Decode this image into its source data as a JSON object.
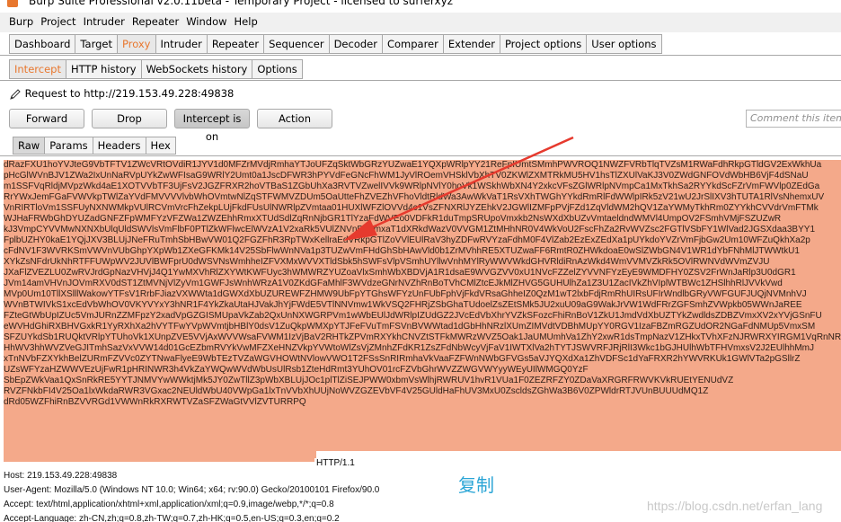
{
  "window": {
    "title": "Burp Suite Professional v2.0.11beta - Temporary Project - licensed to surferxyz"
  },
  "menu": [
    "Burp",
    "Project",
    "Intruder",
    "Repeater",
    "Window",
    "Help"
  ],
  "main_tabs": [
    "Dashboard",
    "Target",
    "Proxy",
    "Intruder",
    "Repeater",
    "Sequencer",
    "Decoder",
    "Comparer",
    "Extender",
    "Project options",
    "User options"
  ],
  "main_tab_active": "Proxy",
  "proxy_tabs": [
    "Intercept",
    "HTTP history",
    "WebSockets history",
    "Options"
  ],
  "proxy_tab_active": "Intercept",
  "request": {
    "label": "Request to http://219.153.49.228:49838"
  },
  "buttons": {
    "forward": "Forward",
    "drop": "Drop",
    "intercept": "Intercept is on",
    "action": "Action"
  },
  "comment": {
    "placeholder": "Comment this item"
  },
  "view_tabs": [
    "Raw",
    "Params",
    "Headers",
    "Hex"
  ],
  "view_tab_active": "Raw",
  "body_lines": [
    "dRazFXU1hoYVJteG9VbTFTV1ZWcVRtOVdiR1JYV1d0MFZrMVdjRmhaYTJoUFZqSktWbGRzYUZwaE1YQXpWRlpYY21ReFpIUmtSMmhPWVROQ1NWZFVRbTlqTVZsM1RWaFdhRkpGTldGV2ExWkhUa",
    "pHcGlWVnBJV1ZWa2IxUnNaRVpUYkZwWFIsaG9WRlY2Umt0a1JscDFWR3hPYVdFeGNcFhWM1JyVlROemVHSklVbXhTV0ZKWlZXMTRkMU5HV1hsTlZXUlVaKJ3V0ZWdGNFOVdWbHB6VjF4dSNaU",
    "m1SSFVqRldjMVpzWkd4aE1XOTVVbTF3UjFsV2JGZFRXR2hoVTBaS1ZGbUhXa3RVTVZwelIVVk9WRlpNVlY0hoVk1WSkhWbXN4Y2xkcVFsZGlWRlpNVmpCa1MxTkhSa2RYYkdScFZrVmFWVlp0ZEdGa",
    "RrYWxJemFGaFVWVkpTWlZaYVdFMVVVVlvbWhOVmtwNlZqSTFWMVZDUm5OaUtteFhZVEZhVFhoVldtRldWa3AwWkVaT1RsVXhTWGhYYkdRmRlFdWWlpIRk5zV21wU2JrSlIXV3hTUTA1RlVsNhemxUV",
    "VnRIRTloVm1SSFUyNXNWMkpVUlRCVmVrcFhZekpLUjFkdFUsUlNWRlpZVmtaa01HUXlWFZlOVVd4c1VsZFNXRlJYZEhkV2JGWlIZMFpPVjFZd1ZqVldWM2hQV1ZaYWMyTkhRm0ZYYkhCVVdrVmFTMk",
    "WJHaFRWbGhDYUZadGNFZFpWMFYzVFZWa1ZWZEhhRmxXTUdSdlZqRnNjbGR1TlYzaFdWVEo0VDFkR1duTmpSRUpoVmxkb2NsWXdXbUZvVmtaeldndWMVl4UmpOV2FSmhVMjFSZUZwR",
    "kJ3VmpCYVVMwNXNXbUlqUldSWVlsVmFlbF0PTlZkWFlwcElWVzA1V2xaRk5VUlZNVnByVmxaT1dXRkdWazV0VVGM1ZtMHhNR0V4WkVoU2FscFhZa2RvWVZsc2FGTlVSbFY1WlVad2JGSXdaa3BYY1",
    "FplbUZHY0kaE1YQjJXV3BLUjJNeFRuTmhSbHBwVW01Q2FGZFhR3RpTWxKellraEdVRkpGTlZoVVlEUlRaV3hyZDFwRVYzaFdhM0F4VlZab2EzExZEdXa1pUYkdoYVZrVmFjbGw2Um10WFZuQkhXa2p",
    "cFdNV1F3WVRKSmVWVnVUbGhpYXpWb1ZXeGFKMk14V25SbFlwWnNVa1p3TUZwVmFHdGhSbHAwVld0b1ZrMVhhRE5XTUZwaFF6RmtR0ZHWkdoaE0wSlZWbGN4V1WR1dYbFNhMlJTWWtkU1",
    "XYkZsNFdrUkNhRTFFUWpWV2JUVlBWFprU0dWSVNsWmhheIZFVXMxWVVXTldSbk5hSWFsVlpVSmhUYllwVnhMYlRyWWVWkdGHVRldiRnAzWkd4WmVVMVZkRk5OVlRWNVdWVmZVJU",
    "JXaFlZVEZLU0ZwRVJrdGpNazVHVjJ4Q1YwMXVhRlZXYWtKWFUyc3hWMWRZYUZoaVlxSmhWbXBDVjA1R1dsaE9WVGZVV0xU1NVcFZZelZYVVNFYzEyE9WMDFHY0ZSV2FrWnJaRlp3U0dGR1",
    "JVm14amVHVnJOVmRXV0dST1ZtMVNjVlZyVm1GWFJsWnhWRzA1V0ZKdGFaMhlF3WVdzeGNrNVZhRnBoTVhCMlZtcEJkMlZHVG5GUHUlhZa1Z3U1ZacIVkZhVIplWTBWc1ZHSlhhRlJVVkVwd",
    "MVp0Um10TllXSlllWakowYTFsV1RrbFJiazVXWWta1dGWXdXbUZUREWFZHMW9UbFpYTGhsWFYzUnFUbFphVjFkdVRsaGhheIZ0QzM1wT2lxbFdjRmRhUIRsUFIrWndlbGRyVWFGUFJUQjNVMnhVJ",
    "WVnBTWIVkS1xcEdVbWhOV0VKYVYxY3hNR1F4YkZkaUtaHJVakJhYjFWdE5VTlNNVmw1WkVSQ2FHRjZSbGhaTUdoelZsZEtSMk5JU2xuU09aG9WakJrVW1WdFRrZGFSmhZVWpkb05WWnJaREE",
    "FZteGtWbUpIZUc5VmJURnZZMFpzY2xadVpGZGISMUpaVkZab2QxUnNXWGRPVm1wWbEUlJdWRlpIZUdGZ2JVcEdVbXhrYVZkSFozcFhiRnBoV1ZkU1JmdVdXbUZTYkZwdldsZDBZVmxXV2xYVjGSnFU",
    "eWVHdGhiRXBHVGxkR1YyRXhXa2hVYTFwYVpWVmtjbHBlY0dsV1ZuQkpWMXpYTJFeFVuTmFSVnBVWWtad1dGbHhNRzlXUmZIMVdtVDBhMUpYY0RGV1IzaFBZmRGZUdOR2NGaFdNMUp5VmxSM",
    "SFZUYkdSb1RUQktVRlpYTUhoVk1XUnpZVE5VVjAxWVVWsaFVWM1IzVjBaV2RHTkZPVmRXYkhCNVZtSTFkMWRzWVZ5Oak1JaUMUmhVa1ZhY2xwR1dsTmpNazV1ZHkxTVhXFzNJRWRXYIRGM1VqRnNRkpZV",
    "HhWV3hhWVZVeGJITmhSazVxVVW14d01GcEZbmRVYkVwMFZXeHNZVkpYVWtoWlZsVjZMnhZFdKR1ZsZFdNbWcyVjFaV1IWTXlVa2hTYTJSWVRFJRjRlI3Wkc1bGJHUlhWbTFHVmxsV2J2EUlhhMmJ",
    "xTnNVbFZXYkhBelZURmFZVVc0ZYTNwaFlyeE9WbTEzTVZaWGVHOWtNVlowVWO1T2FSsSnRIRmhaVkVaaFZFWnNWbGFVGs5aVJYQXdXa1ZhVDFSc1dYaFRXR2hYWVRKUk1GWlVTa2pGSllrZ",
    "UZsWFYzaHZWWVEzUjFwR1pHRINWR3h4VkZaYWQwWVdWbUsUlRsb1ZteHdRmt3YUhOV01rcFZVbGhrWVZZWGVWYyyWEyUIlWMGQ0YzF",
    "SbEpZWkVaa1QxSnRkRE5YYTJNMVYwWWktjMk5JY0ZwTllZ3pWbXBLUjJOc1plTlZiSEJPWW0xbmVsWlhjRWRUV1hvR1VUa1F0ZEZRFZY0ZDaVaXRGRFRWVKVkRUEtYENUdVZ",
    "RVZFNkbFI4V25Oa1lxWkdaRWR3VGxac2NEUldWbU40VWpGa1lxTnVVbXhUUjNoWVZGZEVbVF4V25GUldHaFhUV3MxU0ZscldsZGhWa3B6V0ZPWldrRTJVUnBUUUdMQ1Z",
    "dRd05WZFhiRnBZVVRGd1VWWnRkRXRWTVZaSFZWaGtVVlZVTURRPQ"
  ],
  "http_version": "HTTP/1.1",
  "headers": [
    "Host: 219.153.49.228:49838",
    "User-Agent: Mozilla/5.0 (Windows NT 10.0; Win64; x64; rv:90.0) Gecko/20100101 Firefox/90.0",
    "Accept: text/html,application/xhtml+xml,application/xml;q=0.9,image/webp,*/*;q=0.8",
    "Accept-Language: zh-CN,zh;q=0.8,zh-TW;q=0.7,zh-HK;q=0.5,en-US;q=0.3,en;q=0.2"
  ],
  "annotation": {
    "text": "复制",
    "color": "#2aa5d6"
  },
  "watermark": "https://blog.csdn.net/erfan_lang",
  "colors": {
    "accent": "#e8772e",
    "selection": "#f4a98a",
    "arrow": "#e63a2e"
  }
}
